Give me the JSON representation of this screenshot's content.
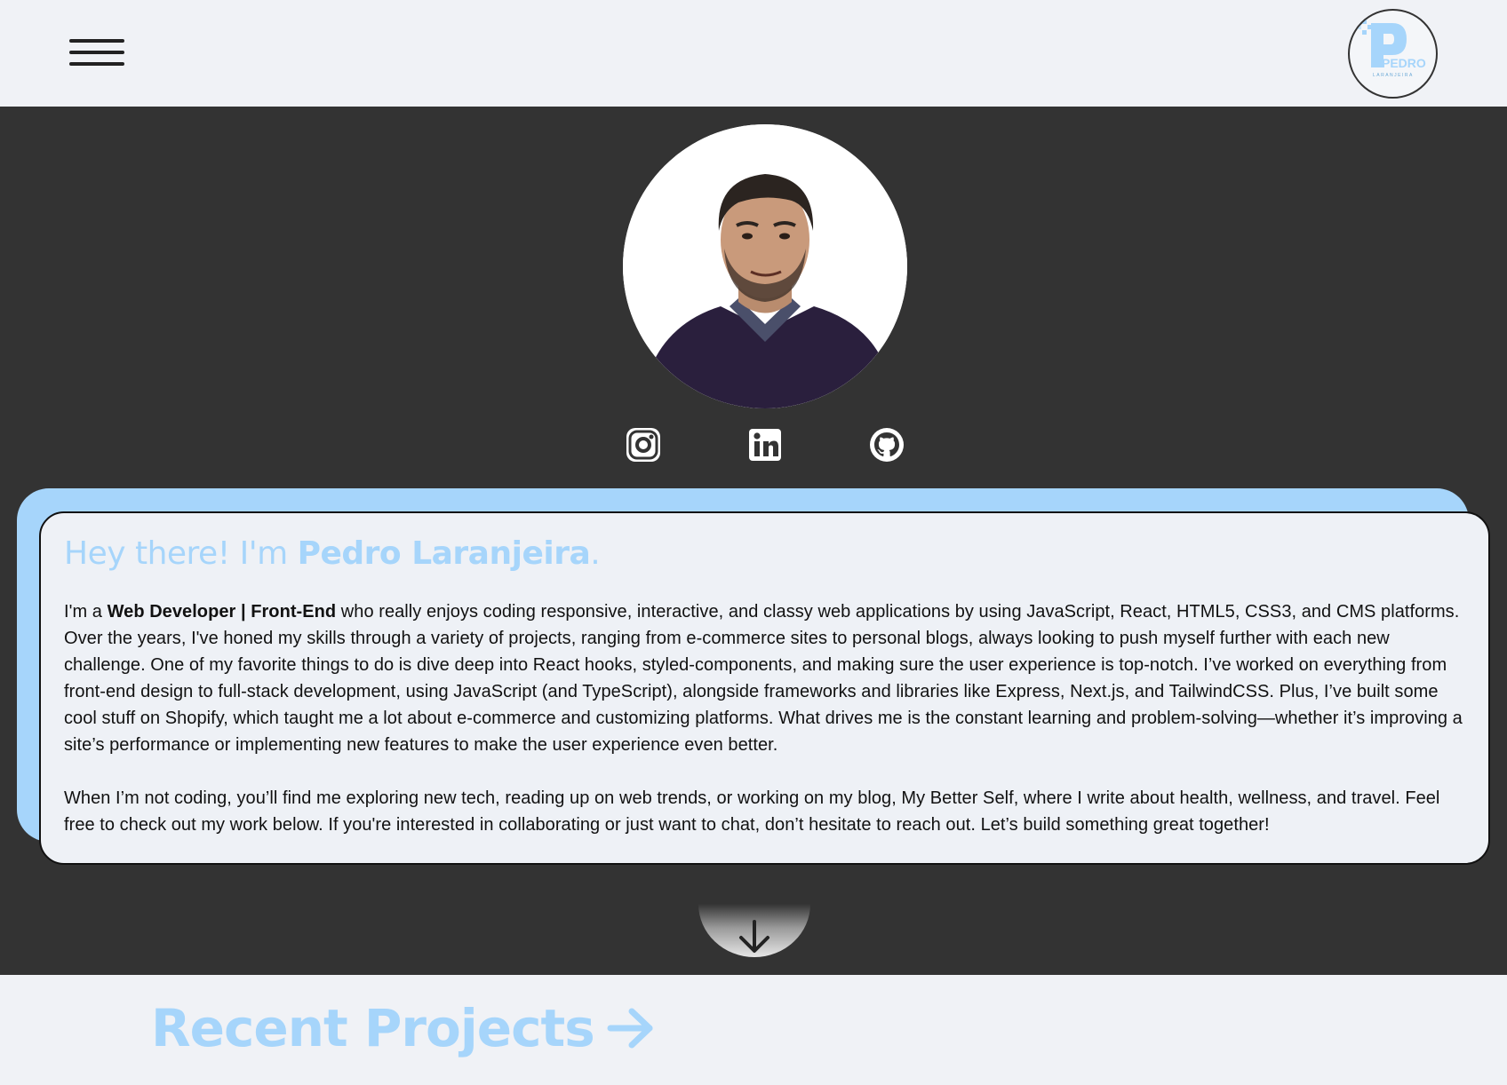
{
  "header": {
    "menu_icon": "hamburger-menu-icon",
    "logo": {
      "main": "PEDRO",
      "sub": "LARANJEIRA"
    }
  },
  "hero": {
    "avatar_alt": "profile-photo",
    "socials": [
      {
        "name": "instagram",
        "icon": "instagram-icon"
      },
      {
        "name": "linkedin",
        "icon": "linkedin-icon"
      },
      {
        "name": "github",
        "icon": "github-icon"
      }
    ]
  },
  "intro": {
    "greeting_prefix": "Hey there! I'm ",
    "name": "Pedro Laranjeira",
    "greeting_suffix": ".",
    "p1_prefix": "I'm a ",
    "role": "Web Developer | Front-End",
    "p1_rest": " who really enjoys coding responsive, interactive, and classy web applications by using JavaScript, React, HTML5, CSS3, and CMS platforms. Over the years, I've honed my skills through a variety of projects, ranging from e-commerce sites to personal blogs, always looking to push myself further with each new challenge. One of my favorite things to do is dive deep into React hooks, styled-components, and making sure the user experience is top-notch. I’ve worked on everything from front-end design to full-stack development, using JavaScript (and TypeScript), alongside frameworks and libraries like Express, Next.js, and TailwindCSS. Plus, I’ve built some cool stuff on Shopify, which taught me a lot about e-commerce and customizing platforms. What drives me is the constant learning and problem-solving—whether it’s improving a site’s performance or implementing new features to make the user experience even better.",
    "p2": "When I’m not coding, you’ll find me exploring new tech, reading up on web trends, or working on my blog, My Better Self, where I write about health, wellness, and travel. Feel free to check out my work below. If you're interested in collaborating or just want to chat, don’t hesitate to reach out. Let’s build something great together!"
  },
  "scroll_button": {
    "icon": "arrow-down-icon"
  },
  "projects": {
    "title": "Recent Projects",
    "icon": "arrow-right-icon"
  },
  "colors": {
    "accent": "#a6d5fb",
    "dark_bg": "#333333",
    "light_bg": "#f0f2f6"
  }
}
